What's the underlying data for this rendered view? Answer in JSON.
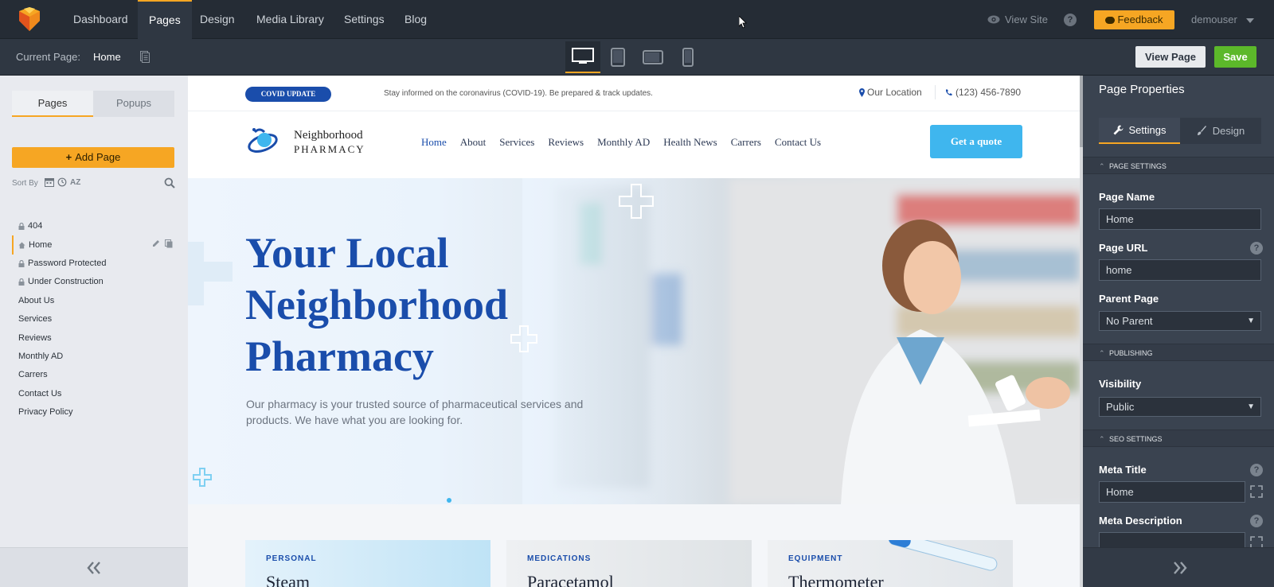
{
  "topnav": {
    "items": [
      "Dashboard",
      "Pages",
      "Design",
      "Media Library",
      "Settings",
      "Blog"
    ],
    "active": "Pages",
    "view_site": "View Site",
    "help": "?",
    "feedback": "Feedback",
    "user": "demouser"
  },
  "toolbar": {
    "current_page_label": "Current Page:",
    "current_page_value": "Home",
    "view_page": "View Page",
    "save": "Save",
    "devices": [
      "desktop",
      "tablet-portrait",
      "tablet-landscape",
      "mobile"
    ],
    "active_device": "desktop"
  },
  "left": {
    "tabs": [
      "Pages",
      "Popups"
    ],
    "active_tab": "Pages",
    "add_page": "Add Page",
    "sort_by": "Sort By",
    "sort_az": "AZ",
    "pages": [
      {
        "label": "404",
        "icon": "lock"
      },
      {
        "label": "Home",
        "icon": "home",
        "active": true
      },
      {
        "label": "Password Protected",
        "icon": "lock"
      },
      {
        "label": "Under Construction",
        "icon": "lock"
      },
      {
        "label": "About Us"
      },
      {
        "label": "Services"
      },
      {
        "label": "Reviews"
      },
      {
        "label": "Monthly AD"
      },
      {
        "label": "Carrers"
      },
      {
        "label": "Contact Us"
      },
      {
        "label": "Privacy Policy"
      }
    ]
  },
  "site": {
    "covid_badge": "COVID UPDATE",
    "covid_text": "Stay informed on the coronavirus (COVID-19). Be prepared & track updates.",
    "location": "Our Location",
    "phone": "(123) 456-7890",
    "logo_line1": "Neighborhood",
    "logo_line2": "PHARMACY",
    "nav": [
      "Home",
      "About",
      "Services",
      "Reviews",
      "Monthly AD",
      "Health News",
      "Carrers",
      "Contact Us"
    ],
    "nav_active": "Home",
    "cta": "Get a quote",
    "hero_title_1": "Your Local",
    "hero_title_2": "Neighborhood",
    "hero_title_3": "Pharmacy",
    "hero_sub": "Our pharmacy is your trusted source of pharmaceutical services and products. We have what you are looking for.",
    "cards": [
      {
        "category": "PERSONAL",
        "title": "Steam"
      },
      {
        "category": "MEDICATIONS",
        "title": "Paracetamol"
      },
      {
        "category": "EQUIPMENT",
        "title": "Thermometer"
      }
    ],
    "colors": {
      "brand": "#1a4dab",
      "accent": "#3fb6ee"
    }
  },
  "right": {
    "title": "Page Properties",
    "tabs": [
      "Settings",
      "Design"
    ],
    "active_tab": "Settings",
    "sections": {
      "page_settings": "PAGE SETTINGS",
      "publishing": "PUBLISHING",
      "seo": "SEO SETTINGS"
    },
    "page_name_label": "Page Name",
    "page_name_value": "Home",
    "page_url_label": "Page URL",
    "page_url_value": "home",
    "parent_page_label": "Parent Page",
    "parent_page_value": "No Parent",
    "visibility_label": "Visibility",
    "visibility_value": "Public",
    "meta_title_label": "Meta Title",
    "meta_title_value": "Home",
    "meta_desc_label": "Meta Description",
    "meta_desc_value": ""
  },
  "colors": {
    "accent": "#f6a623",
    "save_green": "#5cb82a",
    "topbar_bg": "#252c35"
  }
}
